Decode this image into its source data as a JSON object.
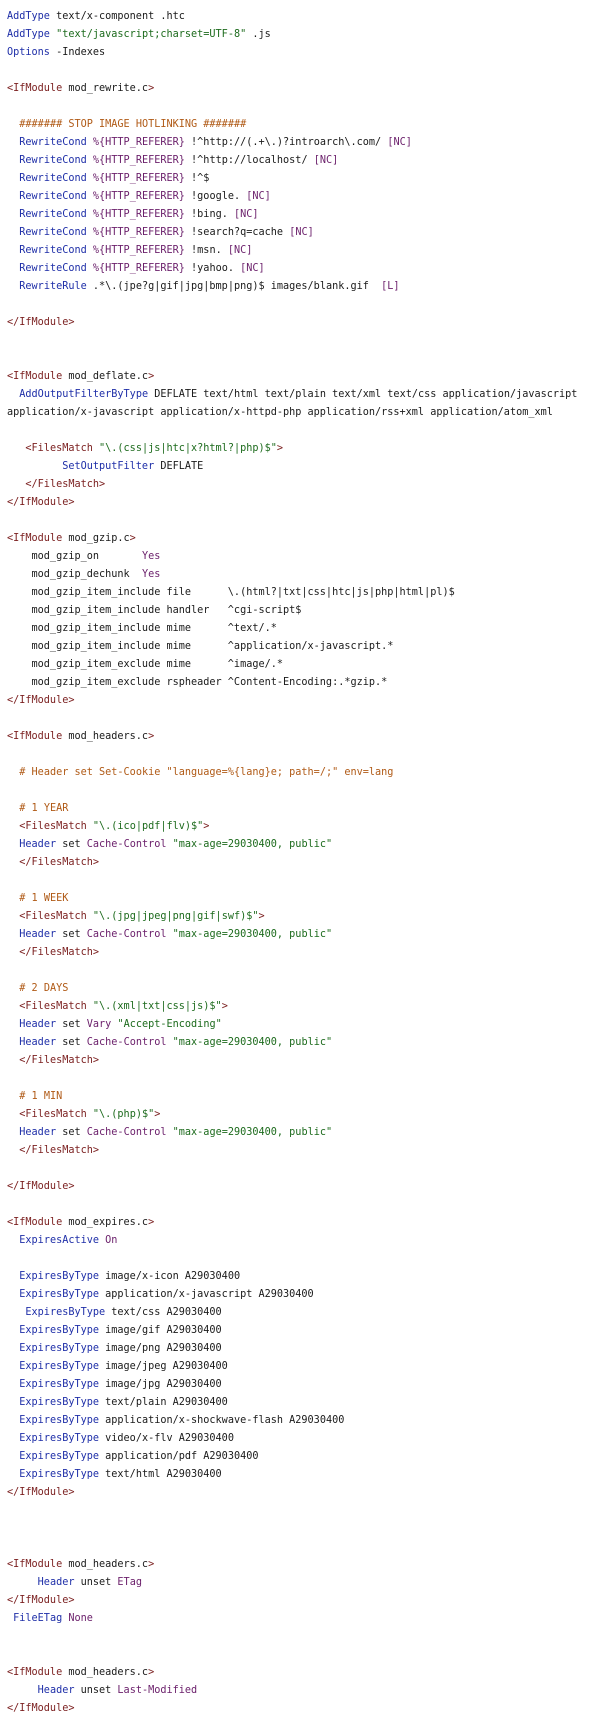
{
  "colors": {
    "directive": "#1f2fa8",
    "tag": "#7a1e1e",
    "string": "#1d6b1d",
    "variable": "#6a1e6a",
    "comment": "#b05a16",
    "text": "#1a1a1a",
    "background": "#ffffff"
  },
  "lines": [
    [
      [
        "dir",
        "AddType"
      ],
      [
        "plain",
        " text/x-component .htc"
      ]
    ],
    [
      [
        "dir",
        "AddType"
      ],
      [
        "plain",
        " "
      ],
      [
        "str",
        "\"text/javascript;charset=UTF-8\""
      ],
      [
        "plain",
        " .js"
      ]
    ],
    [
      [
        "dir",
        "Options"
      ],
      [
        "plain",
        " -Indexes"
      ]
    ],
    [],
    [
      [
        "tag",
        "<IfModule"
      ],
      [
        "plain",
        " mod_rewrite.c"
      ],
      [
        "tag",
        ">"
      ]
    ],
    [],
    [
      [
        "plain",
        "  "
      ],
      [
        "com",
        "####### STOP IMAGE HOTLINKING #######"
      ]
    ],
    [
      [
        "plain",
        "  "
      ],
      [
        "dir",
        "RewriteCond"
      ],
      [
        "plain",
        " "
      ],
      [
        "var",
        "%{HTTP_REFERER}"
      ],
      [
        "plain",
        " !^http://(.+\\.)?introarch\\.com/ "
      ],
      [
        "flag",
        "[NC]"
      ]
    ],
    [
      [
        "plain",
        "  "
      ],
      [
        "dir",
        "RewriteCond"
      ],
      [
        "plain",
        " "
      ],
      [
        "var",
        "%{HTTP_REFERER}"
      ],
      [
        "plain",
        " !^http://localhost/ "
      ],
      [
        "flag",
        "[NC]"
      ]
    ],
    [
      [
        "plain",
        "  "
      ],
      [
        "dir",
        "RewriteCond"
      ],
      [
        "plain",
        " "
      ],
      [
        "var",
        "%{HTTP_REFERER}"
      ],
      [
        "plain",
        " !^$"
      ]
    ],
    [
      [
        "plain",
        "  "
      ],
      [
        "dir",
        "RewriteCond"
      ],
      [
        "plain",
        " "
      ],
      [
        "var",
        "%{HTTP_REFERER}"
      ],
      [
        "plain",
        " !google. "
      ],
      [
        "flag",
        "[NC]"
      ]
    ],
    [
      [
        "plain",
        "  "
      ],
      [
        "dir",
        "RewriteCond"
      ],
      [
        "plain",
        " "
      ],
      [
        "var",
        "%{HTTP_REFERER}"
      ],
      [
        "plain",
        " !bing. "
      ],
      [
        "flag",
        "[NC]"
      ]
    ],
    [
      [
        "plain",
        "  "
      ],
      [
        "dir",
        "RewriteCond"
      ],
      [
        "plain",
        " "
      ],
      [
        "var",
        "%{HTTP_REFERER}"
      ],
      [
        "plain",
        " !search?q=cache "
      ],
      [
        "flag",
        "[NC]"
      ]
    ],
    [
      [
        "plain",
        "  "
      ],
      [
        "dir",
        "RewriteCond"
      ],
      [
        "plain",
        " "
      ],
      [
        "var",
        "%{HTTP_REFERER}"
      ],
      [
        "plain",
        " !msn. "
      ],
      [
        "flag",
        "[NC]"
      ]
    ],
    [
      [
        "plain",
        "  "
      ],
      [
        "dir",
        "RewriteCond"
      ],
      [
        "plain",
        " "
      ],
      [
        "var",
        "%{HTTP_REFERER}"
      ],
      [
        "plain",
        " !yahoo. "
      ],
      [
        "flag",
        "[NC]"
      ]
    ],
    [
      [
        "plain",
        "  "
      ],
      [
        "dir",
        "RewriteRule"
      ],
      [
        "plain",
        " .*\\.(jpe?g|gif|jpg|bmp|png)$ images/blank.gif  "
      ],
      [
        "flag",
        "[L]"
      ]
    ],
    [],
    [
      [
        "tag",
        "</IfModule>"
      ]
    ],
    [],
    [],
    [
      [
        "tag",
        "<IfModule"
      ],
      [
        "plain",
        " mod_deflate.c"
      ],
      [
        "tag",
        ">"
      ]
    ],
    [
      [
        "plain",
        "  "
      ],
      [
        "dir",
        "AddOutputFilterByType"
      ],
      [
        "plain",
        " DEFLATE text/html text/plain text/xml text/css application/javascript"
      ]
    ],
    [
      [
        "plain",
        "application/x-javascript application/x-httpd-php application/rss+xml application/atom_xml"
      ]
    ],
    [],
    [
      [
        "plain",
        "   "
      ],
      [
        "tag",
        "<FilesMatch"
      ],
      [
        "plain",
        " "
      ],
      [
        "str",
        "\"\\.(css|js|htc|x?html?|php)$\""
      ],
      [
        "tag",
        ">"
      ]
    ],
    [
      [
        "plain",
        "         "
      ],
      [
        "dir",
        "SetOutputFilter"
      ],
      [
        "plain",
        " DEFLATE"
      ]
    ],
    [
      [
        "plain",
        "   "
      ],
      [
        "tag",
        "</FilesMatch>"
      ]
    ],
    [
      [
        "tag",
        "</IfModule>"
      ]
    ],
    [],
    [
      [
        "tag",
        "<IfModule"
      ],
      [
        "plain",
        " mod_gzip.c"
      ],
      [
        "tag",
        ">"
      ]
    ],
    [
      [
        "plain",
        "    mod_gzip_on       "
      ],
      [
        "kw",
        "Yes"
      ]
    ],
    [
      [
        "plain",
        "    mod_gzip_dechunk  "
      ],
      [
        "kw",
        "Yes"
      ]
    ],
    [
      [
        "plain",
        "    mod_gzip_item_include file      \\.(html?|txt|css|htc|js|php|html|pl)$"
      ]
    ],
    [
      [
        "plain",
        "    mod_gzip_item_include handler   ^cgi-script$"
      ]
    ],
    [
      [
        "plain",
        "    mod_gzip_item_include mime      ^text/.*"
      ]
    ],
    [
      [
        "plain",
        "    mod_gzip_item_include mime      ^application/x-javascript.*"
      ]
    ],
    [
      [
        "plain",
        "    mod_gzip_item_exclude mime      ^image/.*"
      ]
    ],
    [
      [
        "plain",
        "    mod_gzip_item_exclude rspheader ^Content-Encoding:.*gzip.*"
      ]
    ],
    [
      [
        "tag",
        "</IfModule>"
      ]
    ],
    [],
    [
      [
        "tag",
        "<IfModule"
      ],
      [
        "plain",
        " mod_headers.c"
      ],
      [
        "tag",
        ">"
      ]
    ],
    [],
    [
      [
        "plain",
        "  "
      ],
      [
        "com",
        "# Header set Set-Cookie \"language=%{lang}e; path=/;\" env=lang"
      ]
    ],
    [],
    [
      [
        "plain",
        "  "
      ],
      [
        "com",
        "# 1 YEAR"
      ]
    ],
    [
      [
        "plain",
        "  "
      ],
      [
        "tag",
        "<FilesMatch"
      ],
      [
        "plain",
        " "
      ],
      [
        "str",
        "\"\\.(ico|pdf|flv)$\""
      ],
      [
        "tag",
        ">"
      ]
    ],
    [
      [
        "plain",
        "  "
      ],
      [
        "dir",
        "Header"
      ],
      [
        "plain",
        " set "
      ],
      [
        "var",
        "Cache-Control"
      ],
      [
        "plain",
        " "
      ],
      [
        "str",
        "\"max-age=29030400, public\""
      ]
    ],
    [
      [
        "plain",
        "  "
      ],
      [
        "tag",
        "</FilesMatch>"
      ]
    ],
    [],
    [
      [
        "plain",
        "  "
      ],
      [
        "com",
        "# 1 WEEK"
      ]
    ],
    [
      [
        "plain",
        "  "
      ],
      [
        "tag",
        "<FilesMatch"
      ],
      [
        "plain",
        " "
      ],
      [
        "str",
        "\"\\.(jpg|jpeg|png|gif|swf)$\""
      ],
      [
        "tag",
        ">"
      ]
    ],
    [
      [
        "plain",
        "  "
      ],
      [
        "dir",
        "Header"
      ],
      [
        "plain",
        " set "
      ],
      [
        "var",
        "Cache-Control"
      ],
      [
        "plain",
        " "
      ],
      [
        "str",
        "\"max-age=29030400, public\""
      ]
    ],
    [
      [
        "plain",
        "  "
      ],
      [
        "tag",
        "</FilesMatch>"
      ]
    ],
    [],
    [
      [
        "plain",
        "  "
      ],
      [
        "com",
        "# 2 DAYS"
      ]
    ],
    [
      [
        "plain",
        "  "
      ],
      [
        "tag",
        "<FilesMatch"
      ],
      [
        "plain",
        " "
      ],
      [
        "str",
        "\"\\.(xml|txt|css|js)$\""
      ],
      [
        "tag",
        ">"
      ]
    ],
    [
      [
        "plain",
        "  "
      ],
      [
        "dir",
        "Header"
      ],
      [
        "plain",
        " set "
      ],
      [
        "var",
        "Vary"
      ],
      [
        "plain",
        " "
      ],
      [
        "str",
        "\"Accept-Encoding\""
      ]
    ],
    [
      [
        "plain",
        "  "
      ],
      [
        "dir",
        "Header"
      ],
      [
        "plain",
        " set "
      ],
      [
        "var",
        "Cache-Control"
      ],
      [
        "plain",
        " "
      ],
      [
        "str",
        "\"max-age=29030400, public\""
      ]
    ],
    [
      [
        "plain",
        "  "
      ],
      [
        "tag",
        "</FilesMatch>"
      ]
    ],
    [],
    [
      [
        "plain",
        "  "
      ],
      [
        "com",
        "# 1 MIN"
      ]
    ],
    [
      [
        "plain",
        "  "
      ],
      [
        "tag",
        "<FilesMatch"
      ],
      [
        "plain",
        " "
      ],
      [
        "str",
        "\"\\.(php)$\""
      ],
      [
        "tag",
        ">"
      ]
    ],
    [
      [
        "plain",
        "  "
      ],
      [
        "dir",
        "Header"
      ],
      [
        "plain",
        " set "
      ],
      [
        "var",
        "Cache-Control"
      ],
      [
        "plain",
        " "
      ],
      [
        "str",
        "\"max-age=29030400, public\""
      ]
    ],
    [
      [
        "plain",
        "  "
      ],
      [
        "tag",
        "</FilesMatch>"
      ]
    ],
    [],
    [
      [
        "tag",
        "</IfModule>"
      ]
    ],
    [],
    [
      [
        "tag",
        "<IfModule"
      ],
      [
        "plain",
        " mod_expires.c"
      ],
      [
        "tag",
        ">"
      ]
    ],
    [
      [
        "plain",
        "  "
      ],
      [
        "dir",
        "ExpiresActive"
      ],
      [
        "plain",
        " "
      ],
      [
        "kw",
        "On"
      ]
    ],
    [],
    [
      [
        "plain",
        "  "
      ],
      [
        "dir",
        "ExpiresByType"
      ],
      [
        "plain",
        " image/x-icon A29030400"
      ]
    ],
    [
      [
        "plain",
        "  "
      ],
      [
        "dir",
        "ExpiresByType"
      ],
      [
        "plain",
        " application/x-javascript A29030400"
      ]
    ],
    [
      [
        "plain",
        "   "
      ],
      [
        "dir",
        "ExpiresByType"
      ],
      [
        "plain",
        " text/css A29030400"
      ]
    ],
    [
      [
        "plain",
        "  "
      ],
      [
        "dir",
        "ExpiresByType"
      ],
      [
        "plain",
        " image/gif A29030400"
      ]
    ],
    [
      [
        "plain",
        "  "
      ],
      [
        "dir",
        "ExpiresByType"
      ],
      [
        "plain",
        " image/png A29030400"
      ]
    ],
    [
      [
        "plain",
        "  "
      ],
      [
        "dir",
        "ExpiresByType"
      ],
      [
        "plain",
        " image/jpeg A29030400"
      ]
    ],
    [
      [
        "plain",
        "  "
      ],
      [
        "dir",
        "ExpiresByType"
      ],
      [
        "plain",
        " image/jpg A29030400"
      ]
    ],
    [
      [
        "plain",
        "  "
      ],
      [
        "dir",
        "ExpiresByType"
      ],
      [
        "plain",
        " text/plain A29030400"
      ]
    ],
    [
      [
        "plain",
        "  "
      ],
      [
        "dir",
        "ExpiresByType"
      ],
      [
        "plain",
        " application/x-shockwave-flash A29030400"
      ]
    ],
    [
      [
        "plain",
        "  "
      ],
      [
        "dir",
        "ExpiresByType"
      ],
      [
        "plain",
        " video/x-flv A29030400"
      ]
    ],
    [
      [
        "plain",
        "  "
      ],
      [
        "dir",
        "ExpiresByType"
      ],
      [
        "plain",
        " application/pdf A29030400"
      ]
    ],
    [
      [
        "plain",
        "  "
      ],
      [
        "dir",
        "ExpiresByType"
      ],
      [
        "plain",
        " text/html A29030400"
      ]
    ],
    [
      [
        "tag",
        "</IfModule>"
      ]
    ],
    [],
    [],
    [],
    [
      [
        "tag",
        "<IfModule"
      ],
      [
        "plain",
        " mod_headers.c"
      ],
      [
        "tag",
        ">"
      ]
    ],
    [
      [
        "plain",
        "     "
      ],
      [
        "dir",
        "Header"
      ],
      [
        "plain",
        " unset "
      ],
      [
        "var",
        "ETag"
      ]
    ],
    [
      [
        "tag",
        "</IfModule>"
      ]
    ],
    [
      [
        "plain",
        " "
      ],
      [
        "dir",
        "FileETag"
      ],
      [
        "plain",
        " "
      ],
      [
        "kw",
        "None"
      ]
    ],
    [],
    [],
    [
      [
        "tag",
        "<IfModule"
      ],
      [
        "plain",
        " mod_headers.c"
      ],
      [
        "tag",
        ">"
      ]
    ],
    [
      [
        "plain",
        "     "
      ],
      [
        "dir",
        "Header"
      ],
      [
        "plain",
        " unset "
      ],
      [
        "var",
        "Last-Modified"
      ]
    ],
    [
      [
        "tag",
        "</IfModule>"
      ]
    ]
  ]
}
